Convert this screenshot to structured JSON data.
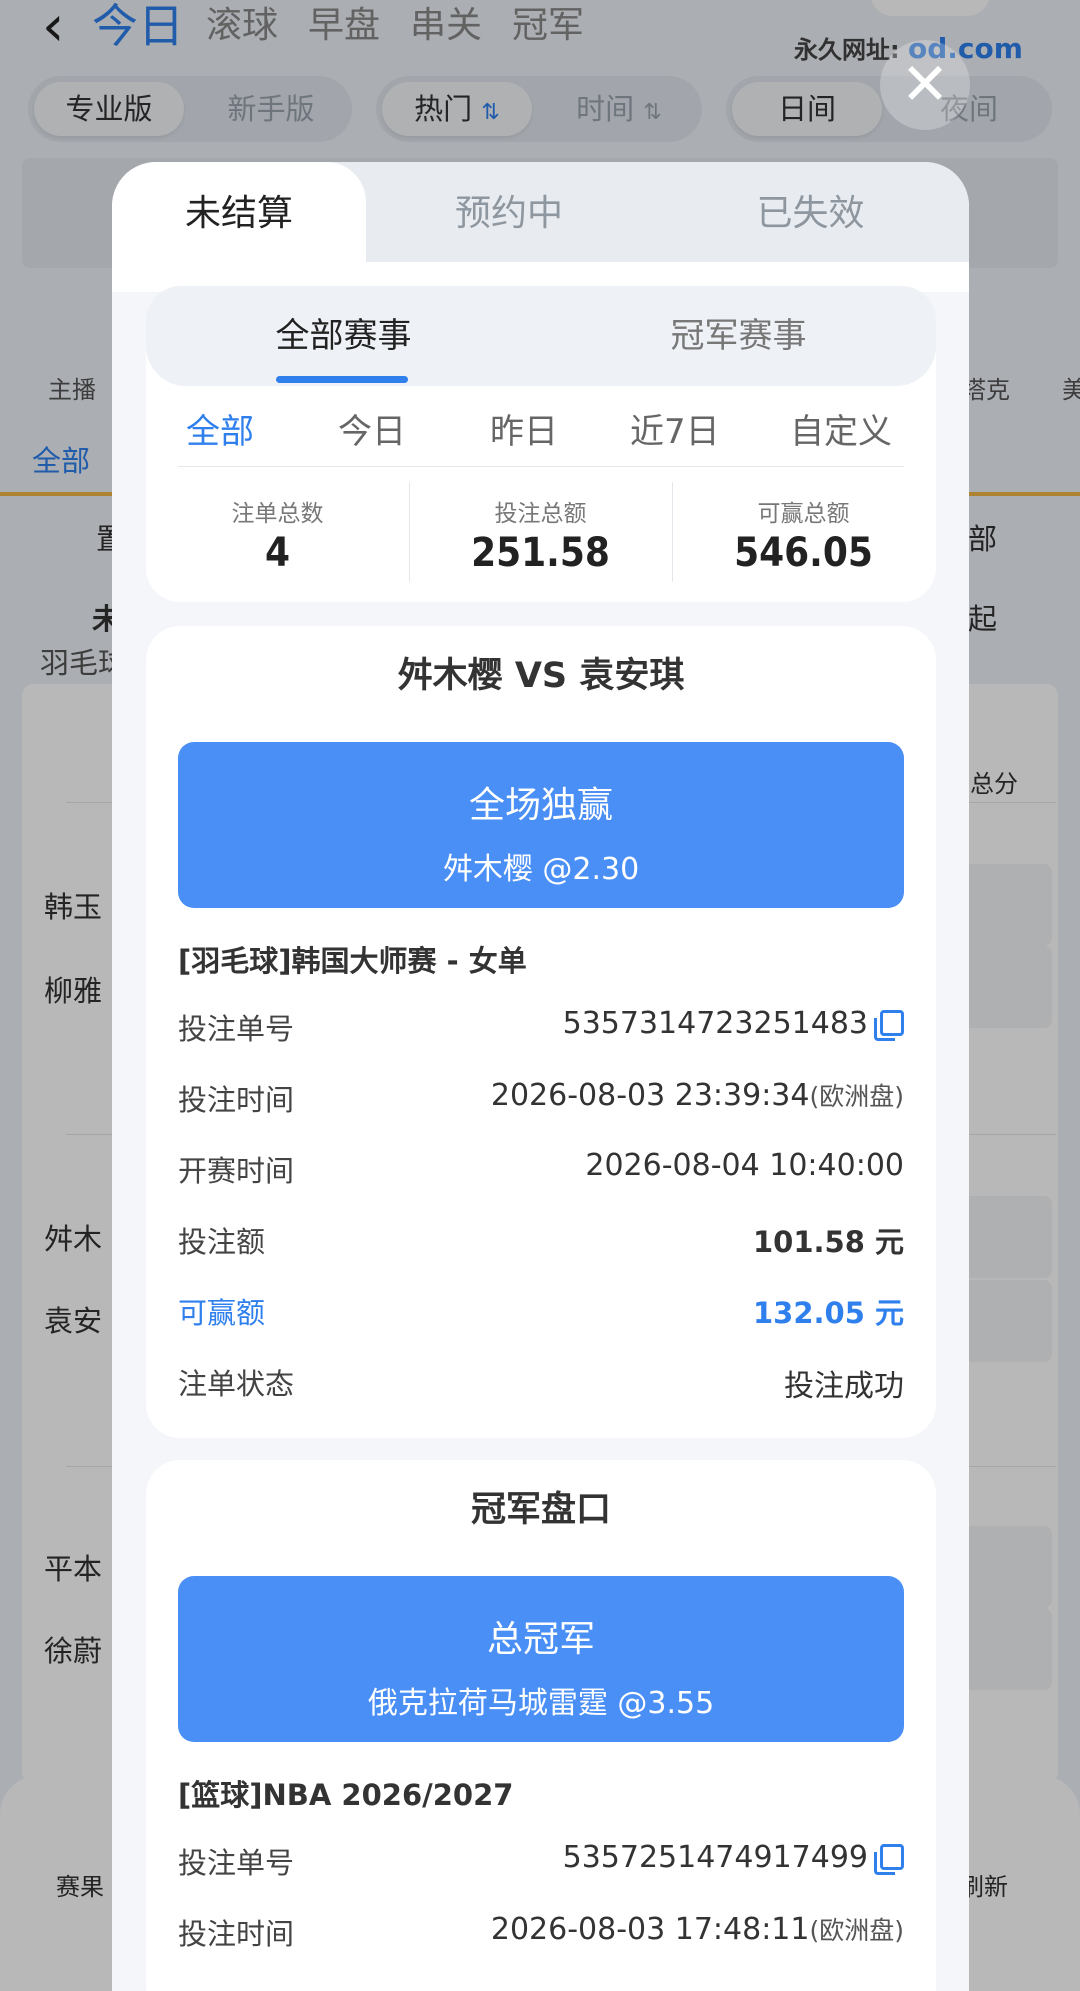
{
  "background": {
    "nav_tabs": [
      "今日",
      "滚球",
      "早盘",
      "串关",
      "冠军"
    ],
    "url_label": "永久网址:",
    "url_value": "od.com",
    "mode_pills": [
      "专业版",
      "新手版"
    ],
    "sort_pills": [
      "热门",
      "时间"
    ],
    "time_pills": [
      "日间",
      "夜间"
    ],
    "icon_labels": [
      "主播",
      "塔克",
      "美"
    ],
    "filter_all": "全部",
    "row_labels": [
      "置",
      "部",
      "未",
      "起",
      "羽毛球",
      "总分"
    ],
    "players": [
      "韩玉",
      "柳雅",
      "舛木",
      "袁安",
      "平本",
      "徐蔚"
    ],
    "bottom_labels": [
      "赛果",
      "刷新"
    ]
  },
  "modal": {
    "status_tabs": [
      "未结算",
      "预约中",
      "已失效"
    ],
    "event_tabs": [
      "全部赛事",
      "冠军赛事"
    ],
    "date_filters": [
      "全部",
      "今日",
      "昨日",
      "近7日",
      "自定义"
    ],
    "stats": [
      {
        "label": "注单总数",
        "value": "4"
      },
      {
        "label": "投注总额",
        "value": "251.58"
      },
      {
        "label": "可赢总额",
        "value": "546.05"
      }
    ],
    "bets": [
      {
        "title": "舛木樱  VS  袁安琪",
        "market": "全场独赢",
        "pick": "舛木樱 @2.30",
        "league": "[羽毛球]韩国大师赛 - 女单",
        "bet_no_label": "投注单号",
        "bet_no": "5357314723251483",
        "bet_time_label": "投注时间",
        "bet_time": "2026-08-03 23:39:34",
        "odds_type": "(欧洲盘)",
        "start_time_label": "开赛时间",
        "start_time": "2026-08-04 10:40:00",
        "stake_label": "投注额",
        "stake": "101.58 元",
        "win_label": "可赢额",
        "win": "132.05 元",
        "status_label": "注单状态",
        "status": "投注成功"
      },
      {
        "title": "冠军盘口",
        "market": "总冠军",
        "pick": "俄克拉荷马城雷霆 @3.55",
        "league": "[篮球]NBA 2026/2027",
        "bet_no_label": "投注单号",
        "bet_no": "5357251474917499",
        "bet_time_label": "投注时间",
        "bet_time": "2026-08-03 17:48:11",
        "odds_type": "(欧洲盘)"
      }
    ]
  },
  "colors": {
    "accent": "#2f80ed",
    "selection_box": "#4a8ff5"
  }
}
